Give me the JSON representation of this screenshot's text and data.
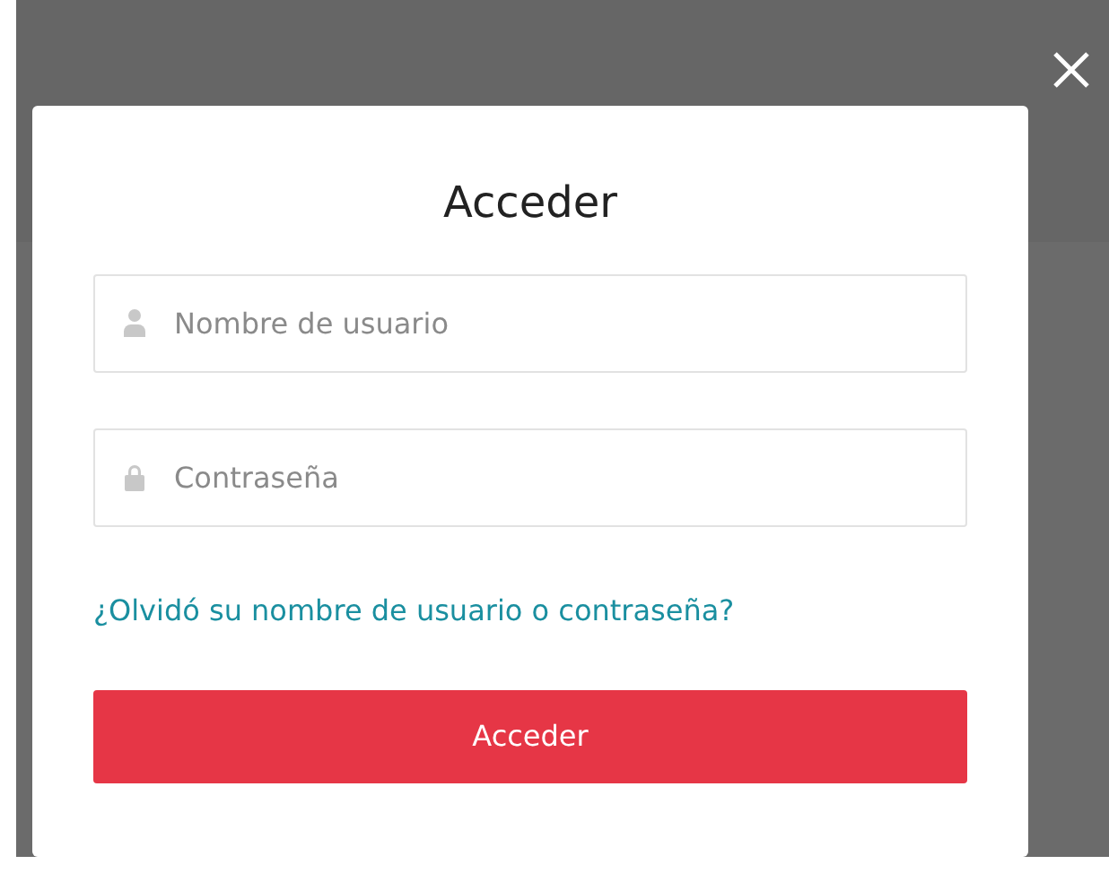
{
  "dialog": {
    "title": "Acceder",
    "fields": [
      {
        "kind": "user",
        "placeholder": "Nombre de usuario"
      },
      {
        "kind": "password",
        "placeholder": "Contraseña"
      }
    ],
    "forgot_link": "¿Olvidó su nombre de usuario o contraseña?",
    "submit_button": "Acceder"
  }
}
